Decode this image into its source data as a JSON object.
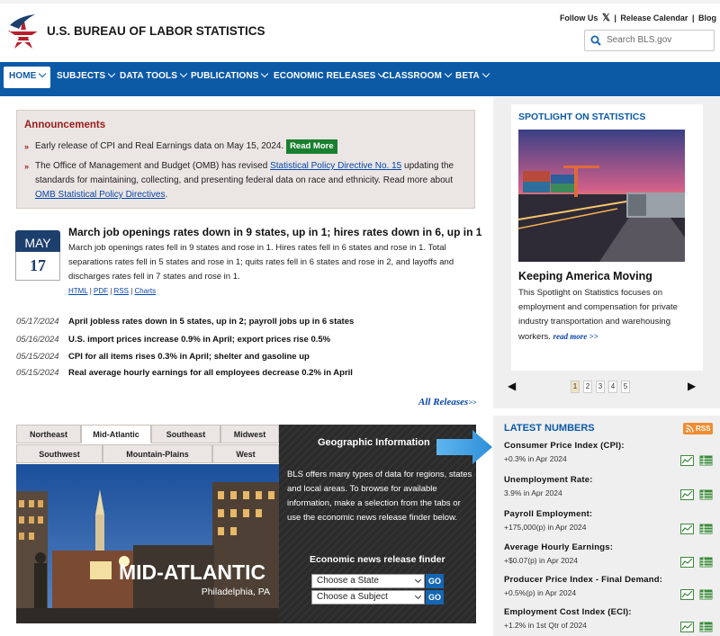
{
  "header": {
    "site_title": "U.S. BUREAU OF LABOR STATISTICS",
    "follow_us": "Follow Us",
    "release_calendar": "Release Calendar",
    "blog": "Blog",
    "separator": "|",
    "search_placeholder": "Search BLS.gov"
  },
  "nav": {
    "items": [
      "HOME",
      "SUBJECTS",
      "DATA TOOLS",
      "PUBLICATIONS",
      "ECONOMIC RELEASES",
      "CLASSROOM",
      "BETA"
    ]
  },
  "announcements": {
    "heading": "Announcements",
    "items": [
      {
        "text": "Early release of CPI and Real Earnings data on May 15, 2024.",
        "button": "Read More"
      },
      {
        "text_before": "The Office of Management and Budget (OMB) has revised ",
        "link": "Statistical Policy Directive No. 15",
        "text_after": " updating the standards for maintaining, collecting, and presenting federal data on race and ethnicity. Read more about ",
        "link2": "OMB Statistical Policy Directives",
        "end": "."
      }
    ]
  },
  "lead_story": {
    "month": "MAY",
    "day": "17",
    "title": "March job openings rates down in 9 states, up in 1; hires rates down in 6, up in 1",
    "body": "March job openings rates fell in 9 states and rose in 1. Hires rates fell in 6 states and rose in 1. Total separations rates fell in 5 states and rose in 1; quits rates fell in 6 states and rose in 2, and layoffs and discharges rates fell in 7 states and rose in 1.",
    "links": [
      "HTML",
      "PDF",
      "RSS",
      "Charts"
    ]
  },
  "releases": [
    {
      "date": "05/17/2024",
      "title": "April jobless rates down in 5 states, up in 2; payroll jobs up in 6 states"
    },
    {
      "date": "05/16/2024",
      "title": "U.S. import prices increase 0.9% in April; export prices rise 0.5%"
    },
    {
      "date": "05/15/2024",
      "title": "CPI for all items rises 0.3% in April; shelter and gasoline up"
    },
    {
      "date": "05/15/2024",
      "title": "Real average hourly earnings for all employees decrease 0.2% in April"
    }
  ],
  "all_releases": "All Releases",
  "all_releases_suffix": ">>",
  "geo": {
    "tabs_row1": [
      "Northeast",
      "Mid-Atlantic",
      "Southeast",
      "Midwest"
    ],
    "tabs_row2": [
      "Southwest",
      "Mountain-Plains",
      "West"
    ],
    "photo_title": "MID-ATLANTIC",
    "photo_subtitle": "Philadelphia, PA",
    "title": "Geographic Information",
    "text": "BLS offers many types of data for regions, states and local areas. To browse for available information, make a selection from the tabs or use the economic news release finder below.",
    "finder_title": "Economic news release finder",
    "state_select": "Choose a State",
    "subject_select": "Choose a Subject",
    "go": "GO"
  },
  "spotlight": {
    "heading": "SPOTLIGHT ON STATISTICS",
    "title": "Keeping America Moving",
    "text": "This Spotlight on Statistics focuses on employment and compensation for private industry transportation and warehousing workers.",
    "read_more": "read more >>",
    "pages": [
      "1",
      "2",
      "3",
      "4",
      "5"
    ],
    "active_page": "1"
  },
  "latest": {
    "heading": "LATEST NUMBERS",
    "rss": "RSS",
    "items": [
      {
        "label": "Consumer Price Index (CPI):",
        "value": "+0.3% in Apr 2024"
      },
      {
        "label": "Unemployment Rate:",
        "value": "3.9% in Apr 2024"
      },
      {
        "label": "Payroll Employment:",
        "value": "+175,000(p) in Apr 2024"
      },
      {
        "label": "Average Hourly Earnings:",
        "value": "+$0.07(p) in Apr 2024"
      },
      {
        "label": "Producer Price Index - Final Demand:",
        "value": "+0.5%(p) in Apr 2024"
      },
      {
        "label": "Employment Cost Index (ECI):",
        "value": "+1.2% in 1st Qtr of 2024"
      }
    ]
  },
  "colors": {
    "nav": "#0c5aa6",
    "brand_red": "#9a1b1b",
    "read_more_green": "#1a7f2f",
    "rss_orange": "#f08c30"
  }
}
